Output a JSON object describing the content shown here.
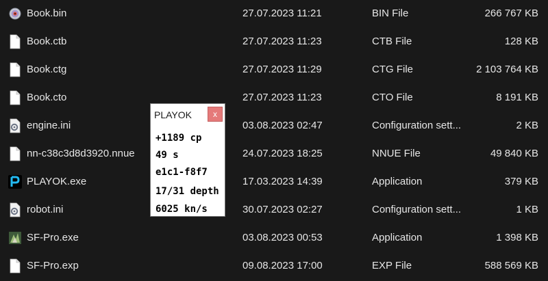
{
  "files": [
    {
      "icon": "disc-image-icon",
      "name": "Book.bin",
      "date": "27.07.2023 11:21",
      "type": "BIN File",
      "size": "266 767 KB"
    },
    {
      "icon": "document-icon",
      "name": "Book.ctb",
      "date": "27.07.2023 11:23",
      "type": "CTB File",
      "size": "128 KB"
    },
    {
      "icon": "document-icon",
      "name": "Book.ctg",
      "date": "27.07.2023 11:29",
      "type": "CTG File",
      "size": "2 103 764 KB"
    },
    {
      "icon": "document-icon",
      "name": "Book.cto",
      "date": "27.07.2023 11:23",
      "type": "CTO File",
      "size": "8 191 KB"
    },
    {
      "icon": "settings-file-icon",
      "name": "engine.ini",
      "date": "03.08.2023 02:47",
      "type": "Configuration sett...",
      "size": "2 KB"
    },
    {
      "icon": "document-icon",
      "name": "nn-c38c3d8d3920.nnue",
      "date": "24.07.2023 18:25",
      "type": "NNUE File",
      "size": "49 840 KB"
    },
    {
      "icon": "playok-app-icon",
      "name": "PLAYOK.exe",
      "date": "17.03.2023 14:39",
      "type": "Application",
      "size": "379 KB"
    },
    {
      "icon": "settings-file-icon",
      "name": "robot.ini",
      "date": "30.07.2023 02:27",
      "type": "Configuration sett...",
      "size": "1 KB"
    },
    {
      "icon": "sf-app-icon",
      "name": "SF-Pro.exe",
      "date": "03.08.2023 00:53",
      "type": "Application",
      "size": "1 398 KB"
    },
    {
      "icon": "document-icon",
      "name": "SF-Pro.exp",
      "date": "09.08.2023 17:00",
      "type": "EXP File",
      "size": "588 569 KB"
    }
  ],
  "popup": {
    "title": "PLAYOK",
    "close_glyph": "x",
    "lines": [
      "+1189 cp",
      "49 s",
      "e1c1-f8f7",
      "17/31 depth",
      "6025 kn/s"
    ]
  },
  "colors": {
    "background": "#191919",
    "text": "#e6e6e6",
    "close_button": "#e57a7a"
  }
}
